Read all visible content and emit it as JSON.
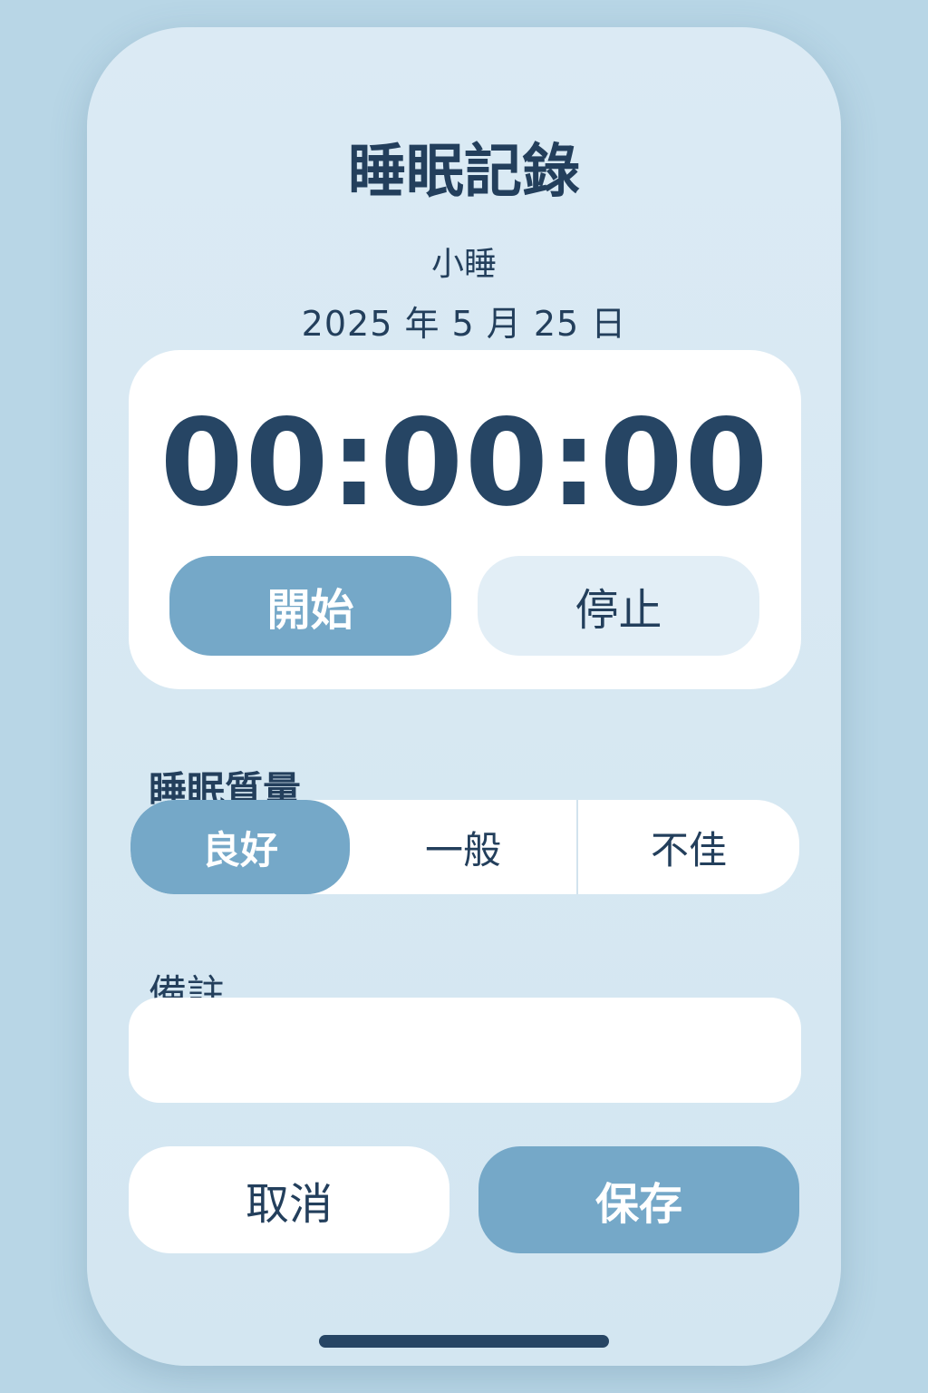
{
  "header": {
    "title": "睡眠記錄",
    "subtitle": "小睡",
    "date": "2025 年 5 月 25 日"
  },
  "timer": {
    "display": "00:00:00",
    "start_label": "開始",
    "stop_label": "停止"
  },
  "quality": {
    "label": "睡眠質量",
    "options": [
      "良好",
      "一般",
      "不佳"
    ],
    "selected": "良好"
  },
  "note": {
    "label": "備註",
    "value": "",
    "placeholder": ""
  },
  "actions": {
    "cancel_label": "取消",
    "save_label": "保存"
  },
  "colors": {
    "background": "#b8d6e6",
    "panel": "#d6e8f3",
    "accent": "#75a8c8",
    "text": "#233f5c"
  }
}
